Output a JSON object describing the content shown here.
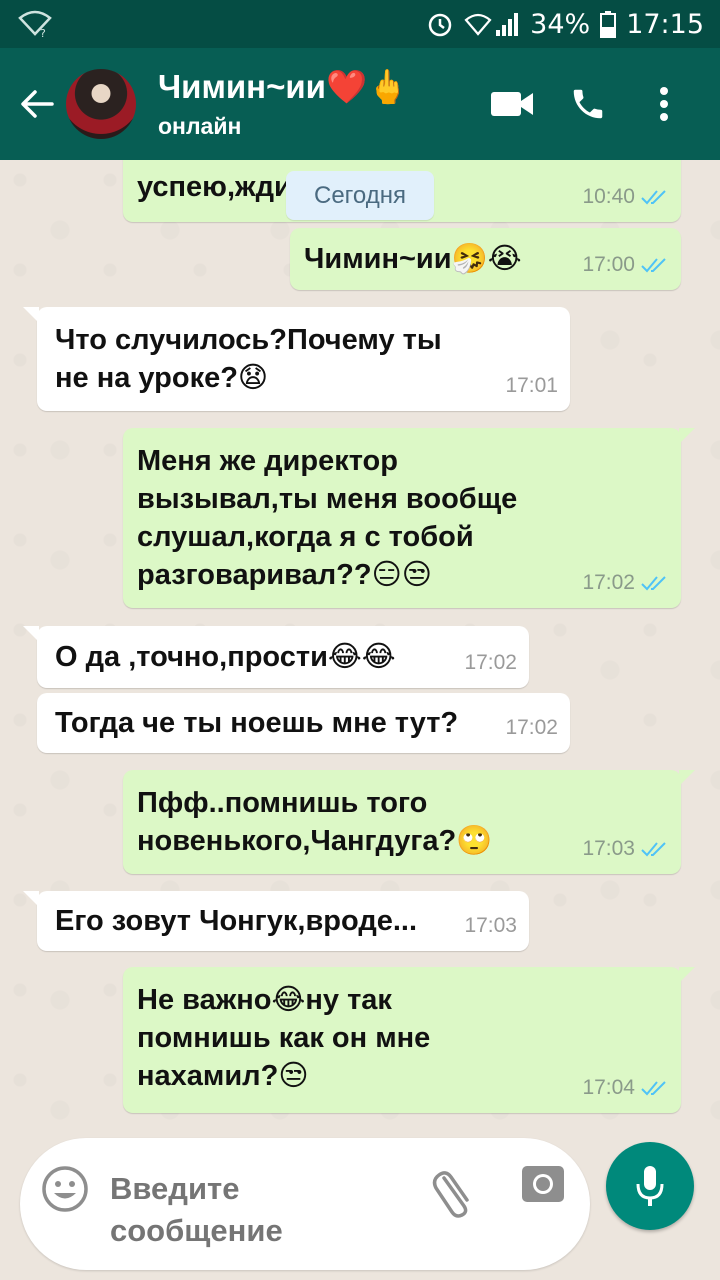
{
  "status_bar": {
    "battery": "34%",
    "time": "17:15"
  },
  "header": {
    "contact_name": "Чимин~ии❤️🖕",
    "contact_status": "онлайн"
  },
  "chat": {
    "date_separator": "Сегодня",
    "messages": [
      {
        "dir": "out",
        "text": "успею,жди😄😍",
        "time": "10:40"
      },
      {
        "dir": "out",
        "text": "Чимин~ии🤧😭",
        "time": "17:00"
      },
      {
        "dir": "in",
        "text": "Что случилось?Почему ты\nне на уроке?😧",
        "time": "17:01"
      },
      {
        "dir": "out",
        "text": "Меня же директор\nвызывал,ты меня вообще\nслушал,когда я с тобой\nразговаривал??😑😒",
        "time": "17:02"
      },
      {
        "dir": "in",
        "text": "О да ,точно,прости😂😂",
        "time": "17:02"
      },
      {
        "dir": "in",
        "text": "Тогда че ты ноешь мне тут?",
        "time": "17:02"
      },
      {
        "dir": "out",
        "text": "Пфф..помнишь того\nновенького,Чангдуга?🙄",
        "time": "17:03"
      },
      {
        "dir": "in",
        "text": "Его зовут Чонгук,вроде...",
        "time": "17:03"
      },
      {
        "dir": "out",
        "text": "Не важно😂ну так\nпомнишь как он мне\nнахамил?😒",
        "time": "17:04"
      }
    ]
  },
  "composer": {
    "placeholder": "Введите\nсообщение"
  },
  "colors": {
    "header": "#075e54",
    "status_bar": "#054d44",
    "outgoing_bubble": "#dcf8c6",
    "incoming_bubble": "#ffffff",
    "read_ticks": "#4fc3f7",
    "mic_button": "#00897b"
  },
  "icons": [
    "wifi-icon",
    "alarm-icon",
    "signal-icon",
    "battery-icon",
    "back-arrow-icon",
    "video-call-icon",
    "phone-icon",
    "more-menu-icon",
    "emoji-icon",
    "attach-icon",
    "camera-icon",
    "mic-icon",
    "double-check-icon"
  ]
}
